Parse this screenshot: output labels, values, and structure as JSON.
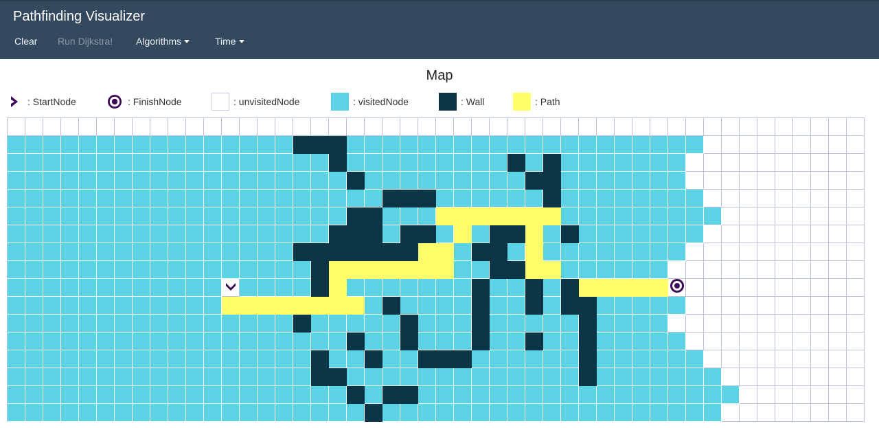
{
  "navbar": {
    "brand": "Pathfinding Visualizer",
    "items": [
      {
        "label": "Clear",
        "disabled": false,
        "dropdown": false
      },
      {
        "label": "Run Dijkstra!",
        "disabled": true,
        "dropdown": false
      },
      {
        "label": "Algorithms",
        "disabled": false,
        "dropdown": true
      },
      {
        "label": "Time",
        "disabled": false,
        "dropdown": true
      }
    ]
  },
  "map": {
    "title": "Map",
    "legend": [
      {
        "label": ": StartNode",
        "icon": "chevron-right-icon"
      },
      {
        "label": ": FinishNode",
        "icon": "target-icon"
      },
      {
        "label": ": unvisitedNode",
        "swatch": "unvisited"
      },
      {
        "label": ": visitedNode",
        "swatch": "visited"
      },
      {
        "label": ": Wall",
        "swatch": "wall"
      },
      {
        "label": ": Path",
        "swatch": "path"
      }
    ]
  },
  "colors": {
    "navbar": "#34495e",
    "visited": "#5bd3e4",
    "wall": "#0c3547",
    "path": "#fffe6a",
    "unvisited": "#ffffff",
    "gridline": "#b8c3d8",
    "icon": "#3d0a55"
  },
  "grid": {
    "rows": 17,
    "cols": 48,
    "start": {
      "row": 8,
      "col": 12,
      "icon": "chevron-down-icon"
    },
    "finish": {
      "row": 8,
      "col": 36,
      "icon": "target-icon"
    },
    "legend_key": "v=visited w=wall p=path .=unvisited S=start F=finish",
    "cells": [
      "................................................",
      "vvvvvvvvvvvvvvvvwwwvvvvvvvvvvvvvvvvvvvv.........",
      "vvvvvvvvvvvvvvvvvvwvvvvvvvvvwvwvvvvvvv..........",
      "vvvvvvvvvvvvvvvvvvvwvvvvvvvvvwwvvvvvvv..........",
      "vvvvvvvvvvvvvvvvvvvvvwwwvvvvvvwvvvvvvvv.........",
      "vvvvvvvvvvvvvvvvvvvwwvvvpppppppvvvvvvvvv........",
      "vvvvvvvvvvvvvvvvvvwwwvwwvpvwwpvwvvvvvvv.........",
      "vvvvvvvvvvvvvvvvwwwwwwwppvwwvpvvvvvvvv..........",
      "vvvvvvvvvvvvvvvvvwpppppppvvwwppvvvvvv...........",
      "vvvvvvvvvvvvSvvvvwpvvvvvvvwvvwvwpppppF..........",
      "vvvvvvvvvvvvppppppppvwvvvvwvvwvwwvvvvv..........",
      "vvvvvvvvvvvvvvvvwvvvvvwvvvwvvvvvwvvvv...........",
      "vvvvvvvvvvvvvvvvvvvwvvwvvvwvvwvvwvvvvv..........",
      "vvvvvvvvvvvvvvvvvwvvwvvwwwvvvvvvwvvvvvv.........",
      "vvvvvvvvvvvvvvvvvwwvvvvvvvvvvvvvwvvvvvvv........",
      "vvvvvvvvvvvvvvvvvvvwvwwvvvvvvvvvvvvvvvvvv.......",
      "vvvvvvvvvvvvvvvvvvvvwvvvvvvvvvvvvvvvvvvv........"
    ]
  }
}
